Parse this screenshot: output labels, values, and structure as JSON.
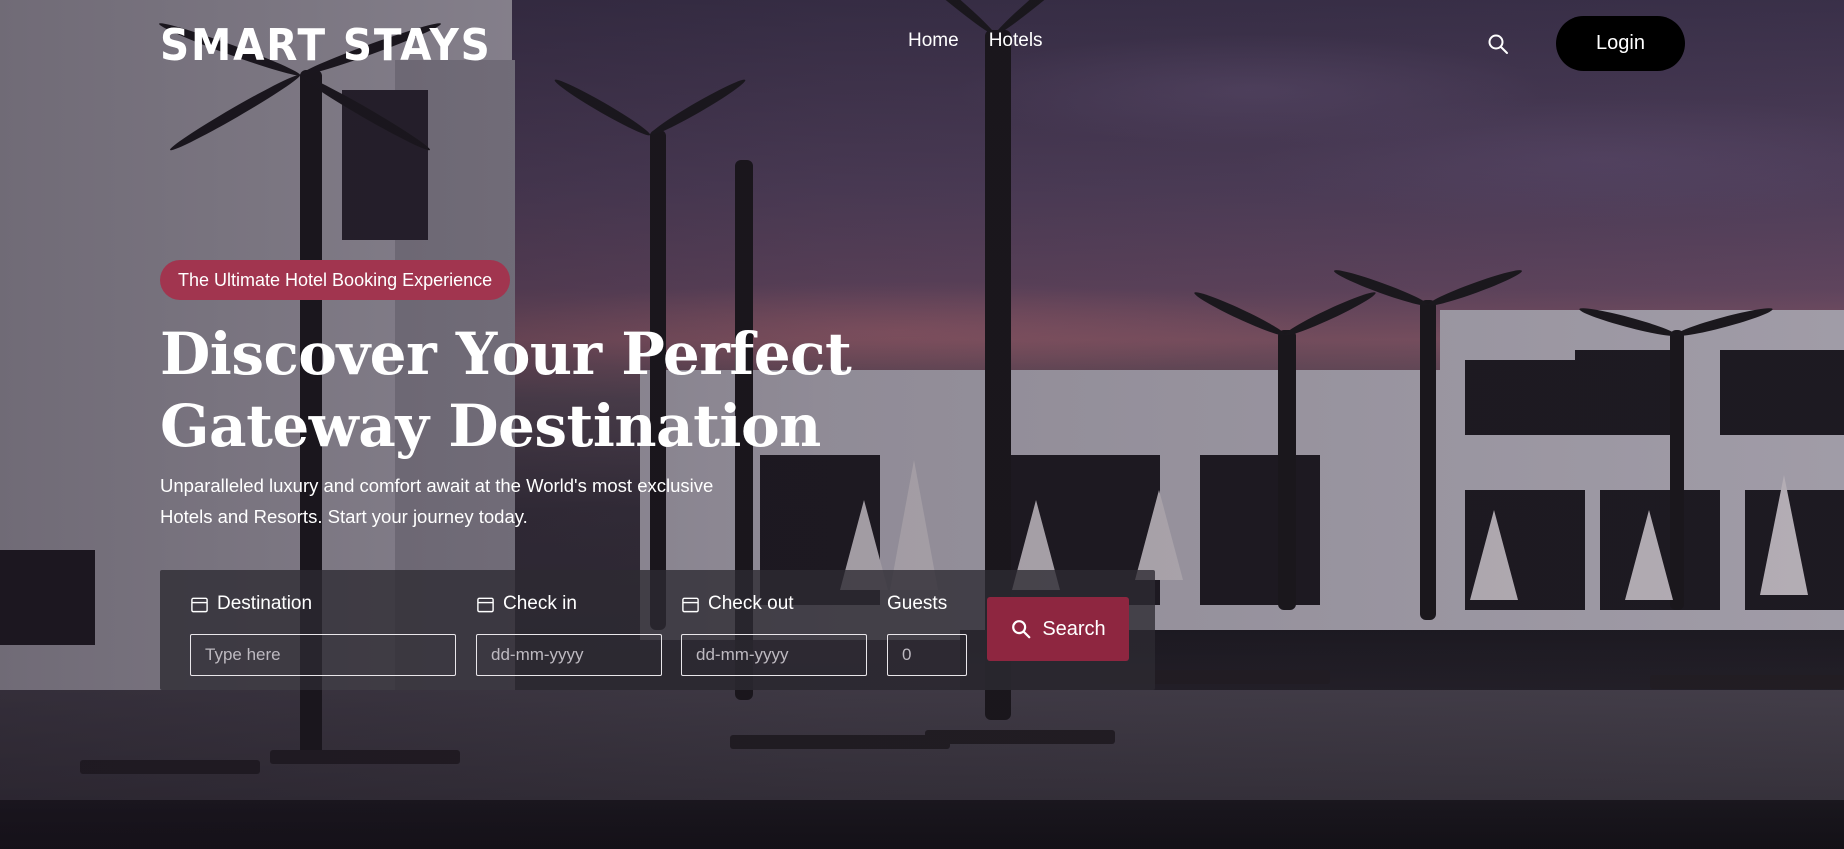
{
  "header": {
    "logo_text": "SMART STAYS",
    "nav": [
      {
        "label": "Home"
      },
      {
        "label": "Hotels"
      }
    ],
    "search_icon": "search-icon",
    "login_label": "Login"
  },
  "hero": {
    "badge": "The Ultimate Hotel Booking Experience",
    "title_line1": "Discover Your Perfect",
    "title_line2": "Gateway Destination",
    "subtitle_line1": "Unparalleled luxury and comfort await at the World's most exclusive",
    "subtitle_line2": "Hotels and Resorts. Start your journey today."
  },
  "search": {
    "destination": {
      "label": "Destination",
      "placeholder": "Type here",
      "icon": "calendar-icon"
    },
    "checkin": {
      "label": "Check in",
      "placeholder": "dd-mm-yyyy",
      "icon": "calendar-icon"
    },
    "checkout": {
      "label": "Check out",
      "placeholder": "dd-mm-yyyy",
      "icon": "calendar-icon"
    },
    "guests": {
      "label": "Guests",
      "placeholder": "0"
    },
    "button_label": "Search",
    "button_icon": "search-icon"
  },
  "colors": {
    "accent": "#8e2640",
    "badge": "#a1354f",
    "login_bg": "#000000"
  }
}
